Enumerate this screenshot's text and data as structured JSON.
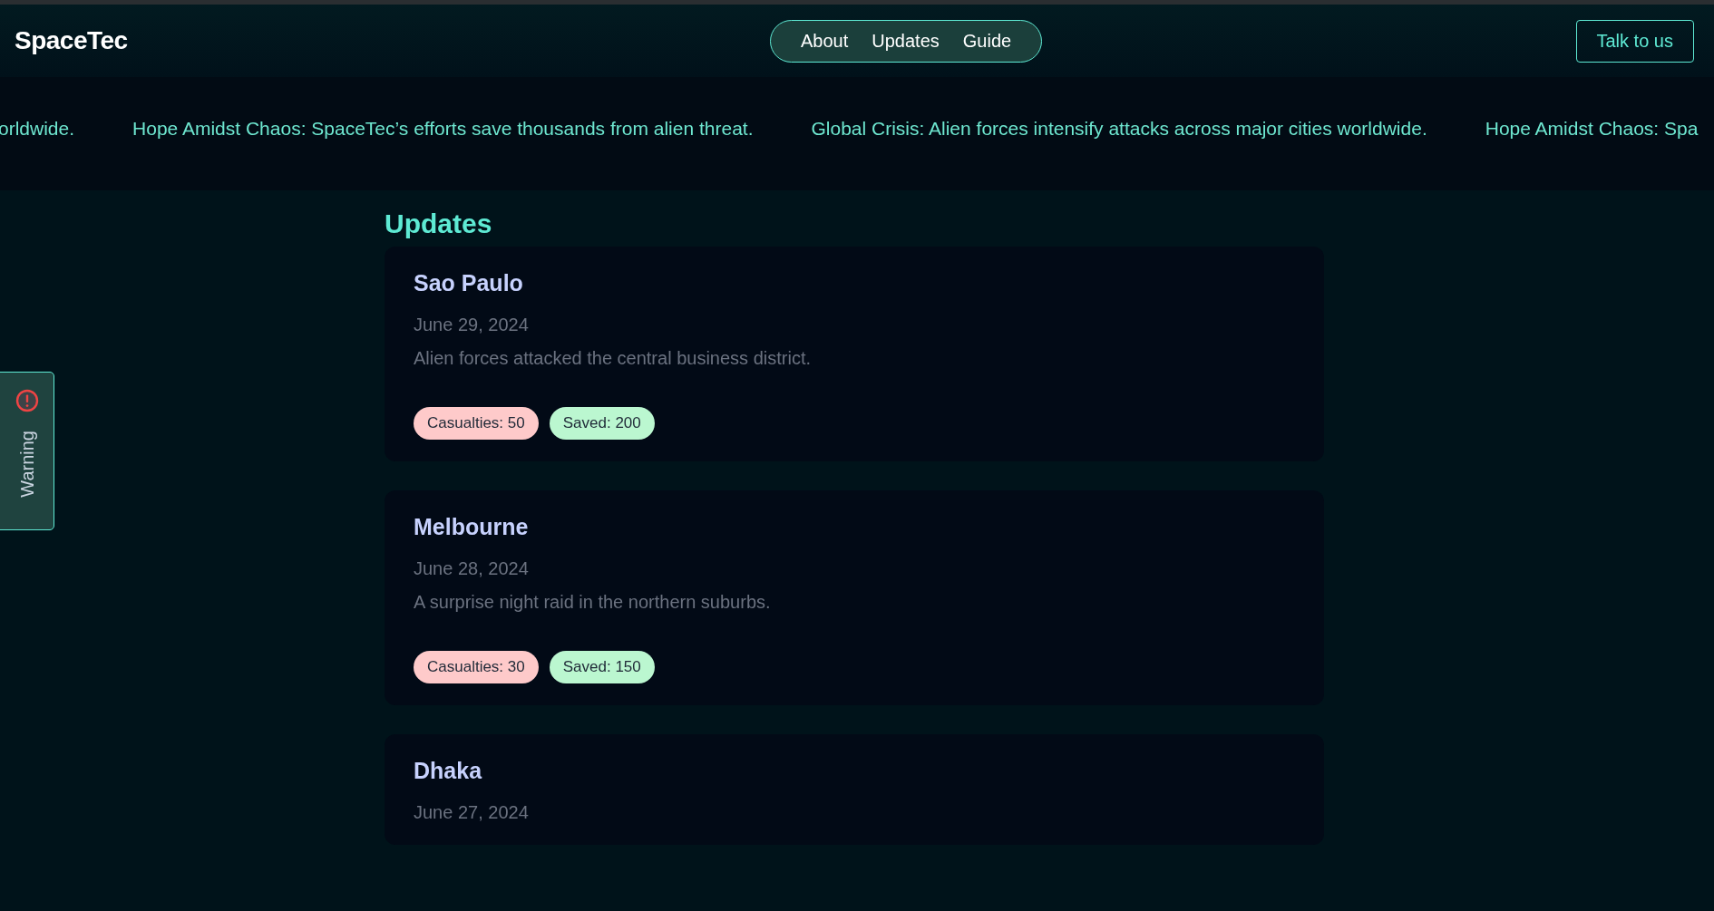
{
  "header": {
    "logo": "SpaceTec",
    "nav": [
      "About",
      "Updates",
      "Guide"
    ],
    "cta": "Talk to us"
  },
  "ticker": [
    "orldwide.",
    "Hope Amidst Chaos: SpaceTec’s efforts save thousands from alien threat.",
    "Global Crisis: Alien forces intensify attacks across major cities worldwide.",
    "Hope Amidst Chaos: Spa"
  ],
  "warning_tab": {
    "label": "Warning"
  },
  "updates": {
    "title": "Updates",
    "items": [
      {
        "city": "Sao Paulo",
        "date": "June 29, 2024",
        "description": "Alien forces attacked the central business district.",
        "badges": [
          {
            "kind": "casualties",
            "text": "Casualties: 50"
          },
          {
            "kind": "saved",
            "text": "Saved: 200"
          }
        ]
      },
      {
        "city": "Melbourne",
        "date": "June 28, 2024",
        "description": "A surprise night raid in the northern suburbs.",
        "badges": [
          {
            "kind": "casualties",
            "text": "Casualties: 30"
          },
          {
            "kind": "saved",
            "text": "Saved: 150"
          }
        ]
      },
      {
        "city": "Dhaka",
        "date": "June 27, 2024"
      }
    ]
  }
}
